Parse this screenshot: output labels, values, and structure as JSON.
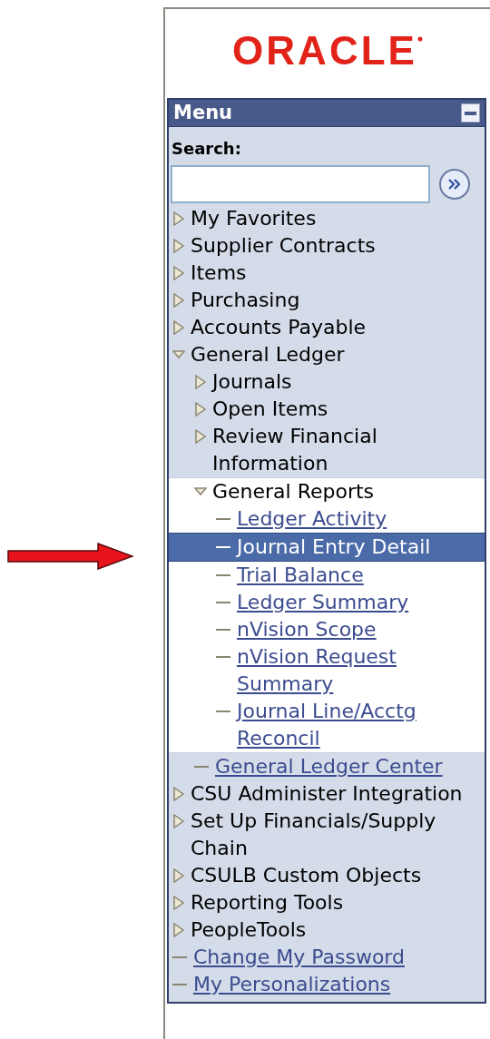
{
  "logo": {
    "text": "ORACLE"
  },
  "menu": {
    "title": "Menu",
    "search": {
      "label": "Search:"
    },
    "items": [
      {
        "kind": "folder",
        "label": "My Favorites",
        "expanded": false,
        "current": false
      },
      {
        "kind": "folder",
        "label": "Supplier Contracts",
        "expanded": false,
        "current": false
      },
      {
        "kind": "folder",
        "label": "Items",
        "expanded": false,
        "current": false
      },
      {
        "kind": "folder",
        "label": "Purchasing",
        "expanded": false,
        "current": false
      },
      {
        "kind": "folder",
        "label": "Accounts Payable",
        "expanded": false,
        "current": false
      },
      {
        "kind": "folder",
        "label": "General Ledger",
        "expanded": true,
        "current": false,
        "children": [
          {
            "kind": "folder",
            "label": "Journals",
            "expanded": false,
            "current": false
          },
          {
            "kind": "folder",
            "label": "Open Items",
            "expanded": false,
            "current": false
          },
          {
            "kind": "folder",
            "label": "Review Financial Information",
            "expanded": false,
            "current": false
          },
          {
            "kind": "folder",
            "label": "General Reports",
            "expanded": true,
            "current": true,
            "children": [
              {
                "kind": "link",
                "label": "Ledger Activity",
                "selected": false
              },
              {
                "kind": "link",
                "label": "Journal Entry Detail",
                "selected": true
              },
              {
                "kind": "link",
                "label": "Trial Balance",
                "selected": false
              },
              {
                "kind": "link",
                "label": "Ledger Summary",
                "selected": false
              },
              {
                "kind": "link",
                "label": "nVision Scope",
                "selected": false
              },
              {
                "kind": "link",
                "label": "nVision Request Summary",
                "selected": false
              },
              {
                "kind": "link",
                "label": "Journal Line/Acctg Reconcil",
                "selected": false
              }
            ]
          },
          {
            "kind": "link",
            "label": "General Ledger Center",
            "selected": false
          }
        ]
      },
      {
        "kind": "folder",
        "label": "CSU Administer Integration",
        "expanded": false,
        "current": false
      },
      {
        "kind": "folder",
        "label": "Set Up Financials/Supply Chain",
        "expanded": false,
        "current": false
      },
      {
        "kind": "folder",
        "label": "CSULB Custom Objects",
        "expanded": false,
        "current": false
      },
      {
        "kind": "folder",
        "label": "Reporting Tools",
        "expanded": false,
        "current": false
      },
      {
        "kind": "folder",
        "label": "PeopleTools",
        "expanded": false,
        "current": false
      },
      {
        "kind": "link",
        "label": "Change My Password",
        "selected": false
      },
      {
        "kind": "link",
        "label": "My Personalizations",
        "selected": false
      }
    ]
  }
}
